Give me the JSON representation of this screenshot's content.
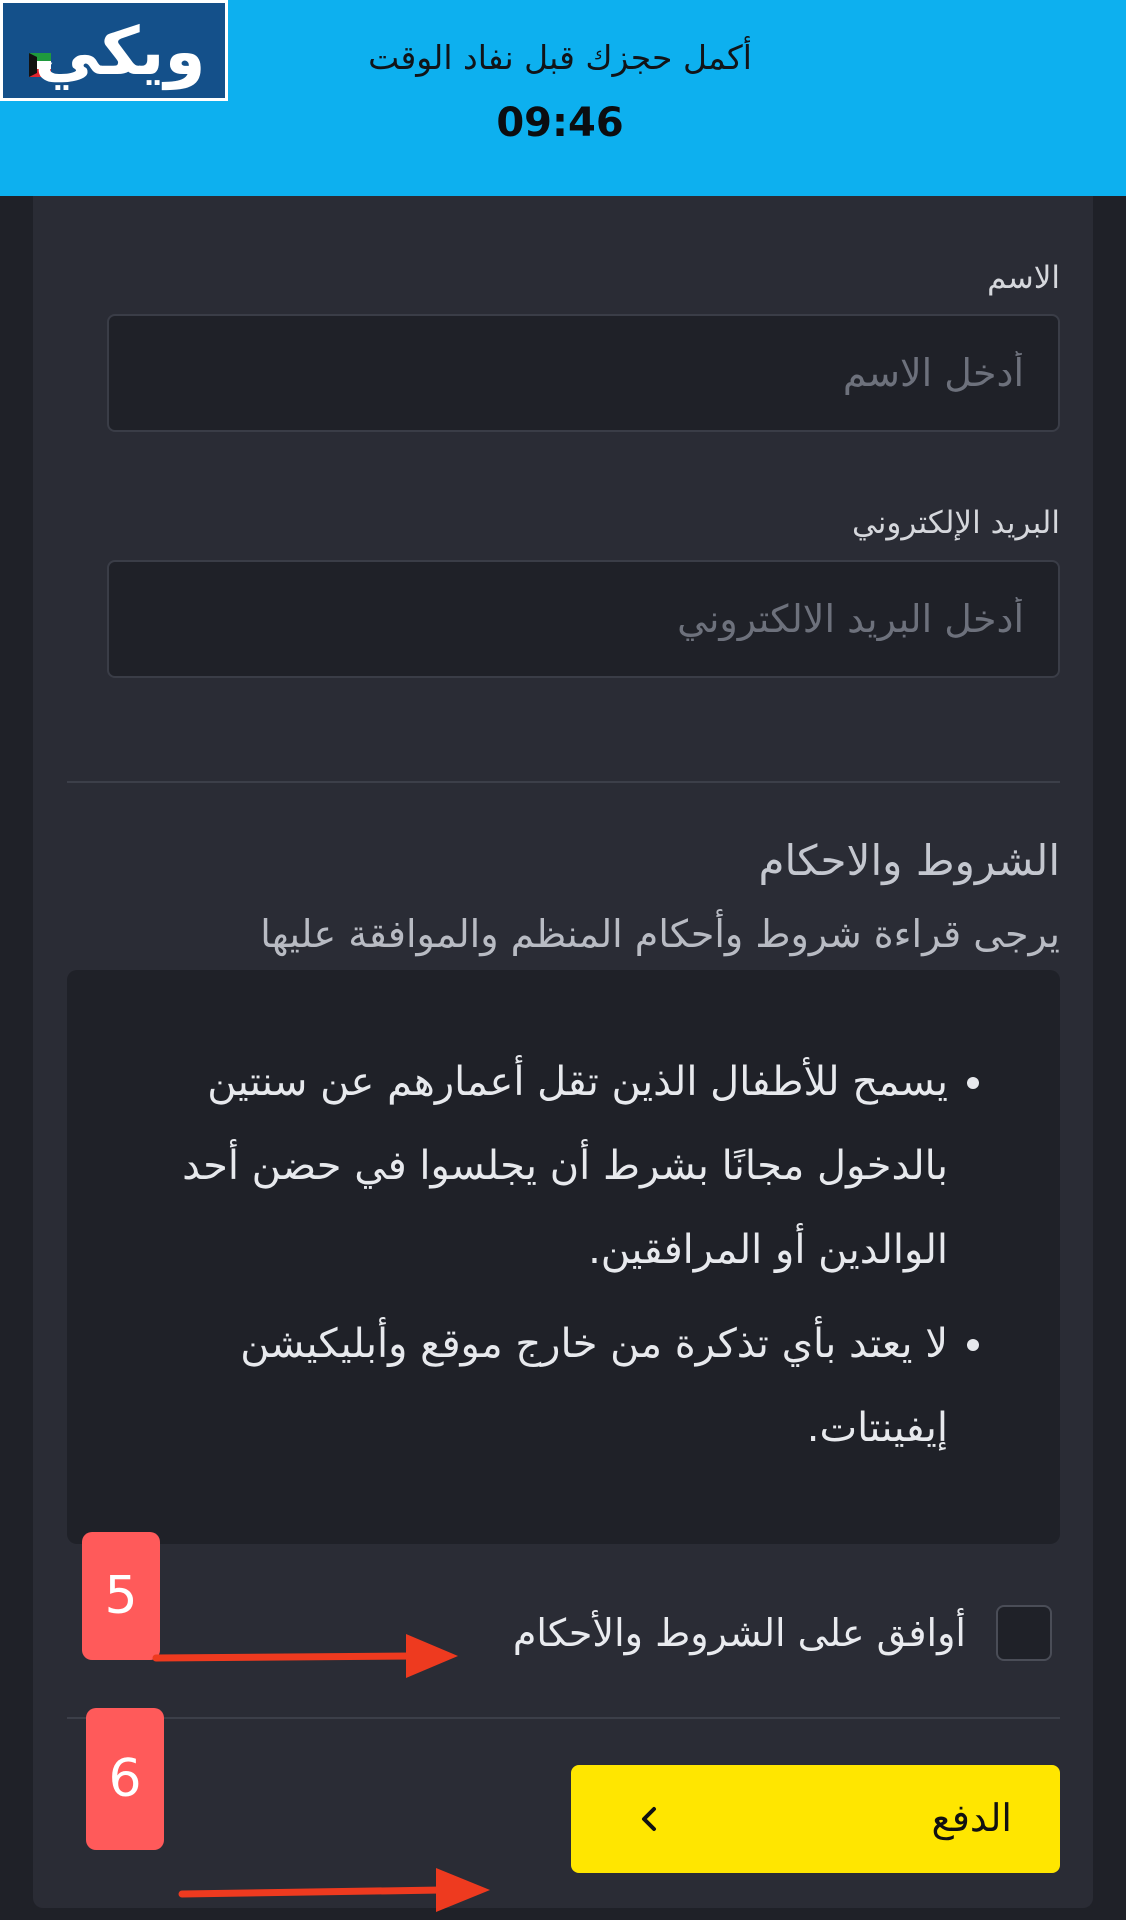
{
  "banner": {
    "logo_text": "ويكي",
    "message": "أكمل حجزك قبل نفاد الوقت",
    "timer": "09:46"
  },
  "form": {
    "name_label": "الاسم",
    "name_placeholder": "أدخل الاسم",
    "name_value": "",
    "email_label": "البريد الإلكتروني",
    "email_placeholder": "أدخل البريد الالكتروني",
    "email_value": ""
  },
  "terms": {
    "title": "الشروط والاحكام",
    "subtitle": "يرجى قراءة شروط وأحكام المنظم والموافقة عليها",
    "items": [
      "يسمح للأطفال الذين تقل أعمارهم عن سنتين بالدخول مجانًا بشرط أن يجلسوا في حضن أحد الوالدين أو المرافقين.",
      "لا يعتد بأي تذكرة من خارج موقع وأبليكيشن إيفينتات."
    ],
    "agree_label": "أوافق على الشروط والأحكام",
    "agree_checked": false
  },
  "payment": {
    "button_label": "الدفع"
  },
  "annotations": {
    "step_5": "5",
    "step_6": "6",
    "color": "#ff5a5a",
    "arrow_color": "#ee3a1f"
  },
  "colors": {
    "banner": "#0db0ef",
    "background": "#1f2128",
    "card": "#2a2c35",
    "pay_button": "#ffe600"
  },
  "icons": [
    "logo",
    "chevron-left-icon",
    "arrow-right-icon"
  ]
}
